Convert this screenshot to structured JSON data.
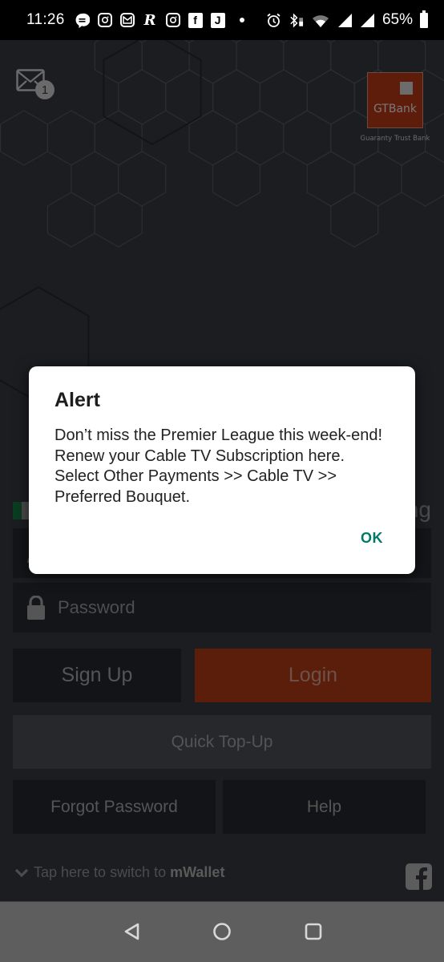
{
  "status_bar": {
    "time": "11:26",
    "notification_icons": [
      "chat-bubble-icon",
      "instagram-icon",
      "gmail-icon",
      "r-app-icon",
      "instagram-icon",
      "facebook-icon",
      "music-app-icon",
      "more-dot-icon"
    ],
    "system_icons": [
      "alarm-icon",
      "bluetooth-icon",
      "wifi-icon",
      "cell-signal-icon",
      "cell-signal-icon"
    ],
    "battery": "65%"
  },
  "header": {
    "messages_badge": "1",
    "brand_name": "GTBank",
    "brand_tagline": "Guaranty Trust Bank"
  },
  "login_form": {
    "greeting_partial": "ng",
    "username_placeholder": "",
    "password_placeholder": "Password",
    "colors": {
      "login_accent": "#5a1e0b",
      "brand": "#5e1c0b"
    }
  },
  "buttons": {
    "sign_up": "Sign Up",
    "login": "Login",
    "quick_topup": "Quick Top-Up",
    "forgot_password": "Forgot Password",
    "help": "Help"
  },
  "footer": {
    "switch_text": "Tap here to switch to",
    "switch_target": "mWallet"
  },
  "dialog": {
    "title": "Alert",
    "message": "Don’t miss the Premier League this week-end! Renew your Cable TV Subscription here. Select Other Payments >> Cable TV >> Preferred Bouquet.",
    "ok_label": "OK",
    "ok_color": "#00796b"
  }
}
